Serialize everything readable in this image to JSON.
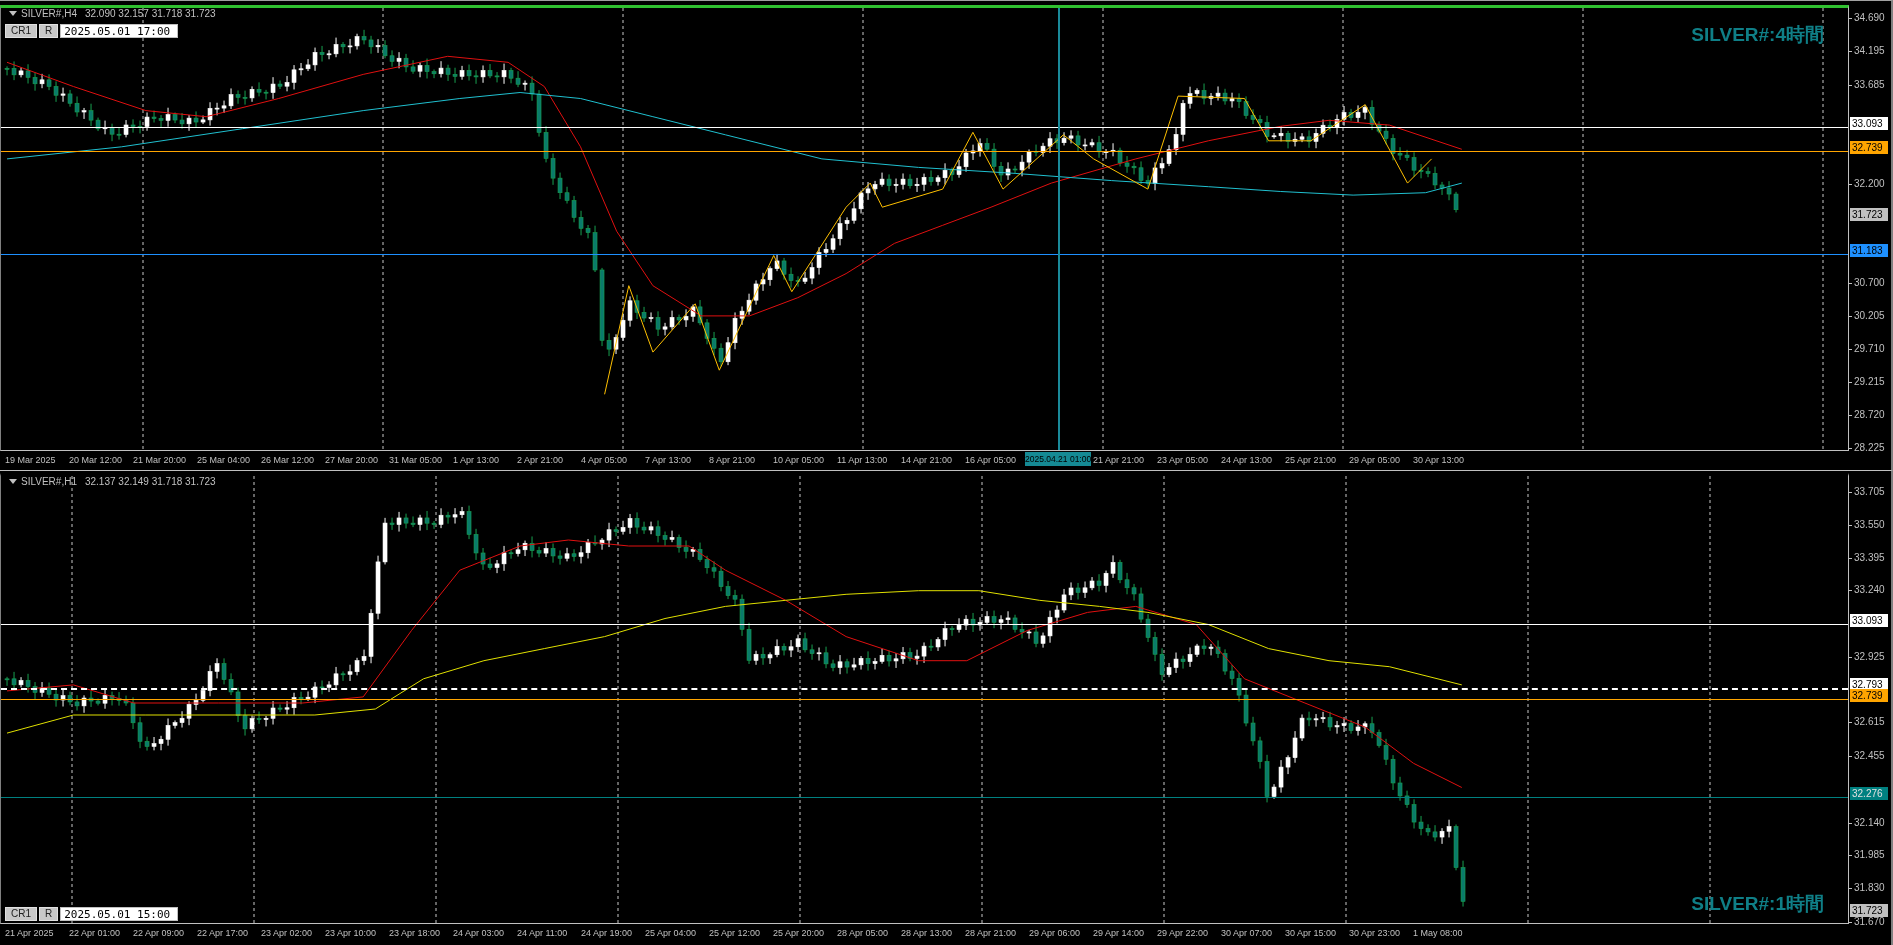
{
  "panes": [
    {
      "active": true,
      "symbol": "SILVER#,H4",
      "ohlc": "32.090 32.157 31.718 31.723",
      "datetime_box": {
        "buttons": [
          "CR1",
          "R"
        ],
        "value": "2025.05.01 17:00"
      },
      "watermark": "SILVER#:4時間",
      "price_ticks": [
        "34.690",
        "34.195",
        "33.685",
        "32.200",
        "30.700",
        "30.205",
        "29.710",
        "29.215",
        "28.720",
        "28.225"
      ],
      "price_lines": [
        {
          "label": "33.093",
          "color": "#ffffff",
          "kind": "solid"
        },
        {
          "label": "32.739",
          "color": "#ffa500",
          "kind": "solid"
        },
        {
          "label": "31.723",
          "color": "#c0c0c0",
          "kind": "current"
        },
        {
          "label": "31.183",
          "color": "#1e90ff",
          "kind": "solid"
        }
      ],
      "time_labels": [
        {
          "text": "19 Mar 2025",
          "kind": "tick"
        },
        {
          "text": "20 Mar 12:00",
          "kind": "tick"
        },
        {
          "text": "21 Mar 20:00",
          "kind": "tick"
        },
        {
          "text": "25 Mar 04:00",
          "kind": "tick"
        },
        {
          "text": "26 Mar 12:00",
          "kind": "tick"
        },
        {
          "text": "27 Mar 20:00",
          "kind": "tick"
        },
        {
          "text": "31 Mar 05:00",
          "kind": "tick"
        },
        {
          "text": "1 Apr 13:00",
          "kind": "tick"
        },
        {
          "text": "2 Apr 21:00",
          "kind": "tick"
        },
        {
          "text": "4 Apr 05:00",
          "kind": "tick"
        },
        {
          "text": "7 Apr 13:00",
          "kind": "tick"
        },
        {
          "text": "8 Apr 21:00",
          "kind": "tick"
        },
        {
          "text": "10 Apr 05:00",
          "kind": "tick"
        },
        {
          "text": "11 Apr 13:00",
          "kind": "tick"
        },
        {
          "text": "14 Apr 21:00",
          "kind": "tick"
        },
        {
          "text": "16 Apr 05:00",
          "kind": "tick"
        },
        {
          "text": "2025.04.21 01:00",
          "kind": "cursor"
        },
        {
          "text": "21 Apr 21:00",
          "kind": "tick"
        },
        {
          "text": "23 Apr 05:00",
          "kind": "tick"
        },
        {
          "text": "24 Apr 13:00",
          "kind": "tick"
        },
        {
          "text": "25 Apr 21:00",
          "kind": "tick"
        },
        {
          "text": "29 Apr 05:00",
          "kind": "tick"
        },
        {
          "text": "30 Apr 13:00",
          "kind": "tick"
        }
      ]
    },
    {
      "active": false,
      "symbol": "SILVER#,H1",
      "ohlc": "32.137 32.149 31.718 31.723",
      "datetime_box": {
        "buttons": [
          "CR1",
          "R"
        ],
        "value": "2025.05.01 15:00"
      },
      "watermark": "SILVER#:1時間",
      "price_ticks": [
        "33.705",
        "33.550",
        "33.395",
        "33.240",
        "32.925",
        "32.615",
        "32.455",
        "32.140",
        "31.985",
        "31.830",
        "31.670"
      ],
      "price_lines": [
        {
          "label": "33.093",
          "color": "#ffffff",
          "kind": "solid"
        },
        {
          "label": "32.793",
          "color": "#ffffff",
          "kind": "dashed"
        },
        {
          "label": "32.739",
          "color": "#ffa500",
          "kind": "solid"
        },
        {
          "label": "32.276",
          "color": "#008080",
          "kind": "solid"
        },
        {
          "label": "31.723",
          "color": "#c0c0c0",
          "kind": "current"
        }
      ],
      "time_labels": [
        {
          "text": "21 Apr 2025",
          "kind": "tick"
        },
        {
          "text": "22 Apr 01:00",
          "kind": "tick"
        },
        {
          "text": "22 Apr 09:00",
          "kind": "tick"
        },
        {
          "text": "22 Apr 17:00",
          "kind": "tick"
        },
        {
          "text": "23 Apr 02:00",
          "kind": "tick"
        },
        {
          "text": "23 Apr 10:00",
          "kind": "tick"
        },
        {
          "text": "23 Apr 18:00",
          "kind": "tick"
        },
        {
          "text": "24 Apr 03:00",
          "kind": "tick"
        },
        {
          "text": "24 Apr 11:00",
          "kind": "tick"
        },
        {
          "text": "24 Apr 19:00",
          "kind": "tick"
        },
        {
          "text": "25 Apr 04:00",
          "kind": "tick"
        },
        {
          "text": "25 Apr 12:00",
          "kind": "tick"
        },
        {
          "text": "25 Apr 20:00",
          "kind": "tick"
        },
        {
          "text": "28 Apr 05:00",
          "kind": "tick"
        },
        {
          "text": "28 Apr 13:00",
          "kind": "tick"
        },
        {
          "text": "28 Apr 21:00",
          "kind": "tick"
        },
        {
          "text": "29 Apr 06:00",
          "kind": "tick"
        },
        {
          "text": "29 Apr 14:00",
          "kind": "tick"
        },
        {
          "text": "29 Apr 22:00",
          "kind": "tick"
        },
        {
          "text": "30 Apr 07:00",
          "kind": "tick"
        },
        {
          "text": "30 Apr 15:00",
          "kind": "tick"
        },
        {
          "text": "30 Apr 23:00",
          "kind": "tick"
        },
        {
          "text": "1 May 08:00",
          "kind": "tick"
        }
      ]
    }
  ]
}
